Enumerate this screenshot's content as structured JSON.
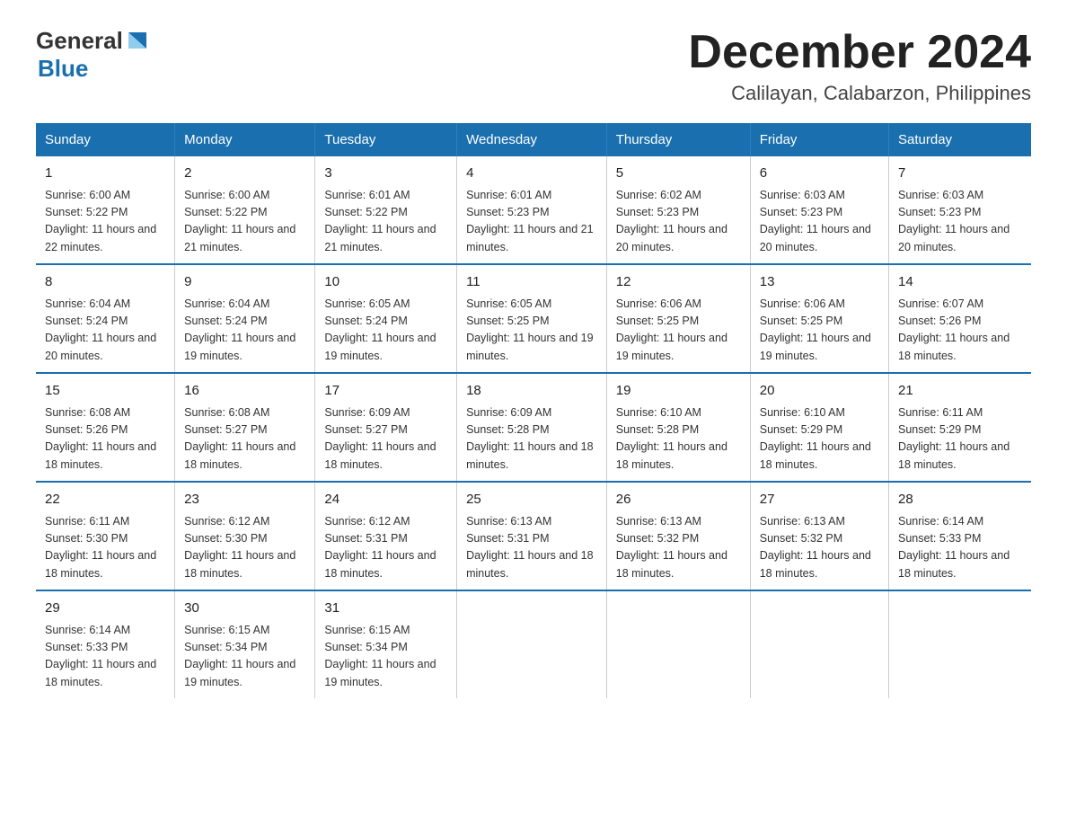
{
  "header": {
    "logo_general": "General",
    "logo_blue": "Blue",
    "main_title": "December 2024",
    "subtitle": "Calilayan, Calabarzon, Philippines"
  },
  "days_of_week": [
    "Sunday",
    "Monday",
    "Tuesday",
    "Wednesday",
    "Thursday",
    "Friday",
    "Saturday"
  ],
  "weeks": [
    [
      {
        "day": "1",
        "sunrise": "6:00 AM",
        "sunset": "5:22 PM",
        "daylight": "11 hours and 22 minutes."
      },
      {
        "day": "2",
        "sunrise": "6:00 AM",
        "sunset": "5:22 PM",
        "daylight": "11 hours and 21 minutes."
      },
      {
        "day": "3",
        "sunrise": "6:01 AM",
        "sunset": "5:22 PM",
        "daylight": "11 hours and 21 minutes."
      },
      {
        "day": "4",
        "sunrise": "6:01 AM",
        "sunset": "5:23 PM",
        "daylight": "11 hours and 21 minutes."
      },
      {
        "day": "5",
        "sunrise": "6:02 AM",
        "sunset": "5:23 PM",
        "daylight": "11 hours and 20 minutes."
      },
      {
        "day": "6",
        "sunrise": "6:03 AM",
        "sunset": "5:23 PM",
        "daylight": "11 hours and 20 minutes."
      },
      {
        "day": "7",
        "sunrise": "6:03 AM",
        "sunset": "5:23 PM",
        "daylight": "11 hours and 20 minutes."
      }
    ],
    [
      {
        "day": "8",
        "sunrise": "6:04 AM",
        "sunset": "5:24 PM",
        "daylight": "11 hours and 20 minutes."
      },
      {
        "day": "9",
        "sunrise": "6:04 AM",
        "sunset": "5:24 PM",
        "daylight": "11 hours and 19 minutes."
      },
      {
        "day": "10",
        "sunrise": "6:05 AM",
        "sunset": "5:24 PM",
        "daylight": "11 hours and 19 minutes."
      },
      {
        "day": "11",
        "sunrise": "6:05 AM",
        "sunset": "5:25 PM",
        "daylight": "11 hours and 19 minutes."
      },
      {
        "day": "12",
        "sunrise": "6:06 AM",
        "sunset": "5:25 PM",
        "daylight": "11 hours and 19 minutes."
      },
      {
        "day": "13",
        "sunrise": "6:06 AM",
        "sunset": "5:25 PM",
        "daylight": "11 hours and 19 minutes."
      },
      {
        "day": "14",
        "sunrise": "6:07 AM",
        "sunset": "5:26 PM",
        "daylight": "11 hours and 18 minutes."
      }
    ],
    [
      {
        "day": "15",
        "sunrise": "6:08 AM",
        "sunset": "5:26 PM",
        "daylight": "11 hours and 18 minutes."
      },
      {
        "day": "16",
        "sunrise": "6:08 AM",
        "sunset": "5:27 PM",
        "daylight": "11 hours and 18 minutes."
      },
      {
        "day": "17",
        "sunrise": "6:09 AM",
        "sunset": "5:27 PM",
        "daylight": "11 hours and 18 minutes."
      },
      {
        "day": "18",
        "sunrise": "6:09 AM",
        "sunset": "5:28 PM",
        "daylight": "11 hours and 18 minutes."
      },
      {
        "day": "19",
        "sunrise": "6:10 AM",
        "sunset": "5:28 PM",
        "daylight": "11 hours and 18 minutes."
      },
      {
        "day": "20",
        "sunrise": "6:10 AM",
        "sunset": "5:29 PM",
        "daylight": "11 hours and 18 minutes."
      },
      {
        "day": "21",
        "sunrise": "6:11 AM",
        "sunset": "5:29 PM",
        "daylight": "11 hours and 18 minutes."
      }
    ],
    [
      {
        "day": "22",
        "sunrise": "6:11 AM",
        "sunset": "5:30 PM",
        "daylight": "11 hours and 18 minutes."
      },
      {
        "day": "23",
        "sunrise": "6:12 AM",
        "sunset": "5:30 PM",
        "daylight": "11 hours and 18 minutes."
      },
      {
        "day": "24",
        "sunrise": "6:12 AM",
        "sunset": "5:31 PM",
        "daylight": "11 hours and 18 minutes."
      },
      {
        "day": "25",
        "sunrise": "6:13 AM",
        "sunset": "5:31 PM",
        "daylight": "11 hours and 18 minutes."
      },
      {
        "day": "26",
        "sunrise": "6:13 AM",
        "sunset": "5:32 PM",
        "daylight": "11 hours and 18 minutes."
      },
      {
        "day": "27",
        "sunrise": "6:13 AM",
        "sunset": "5:32 PM",
        "daylight": "11 hours and 18 minutes."
      },
      {
        "day": "28",
        "sunrise": "6:14 AM",
        "sunset": "5:33 PM",
        "daylight": "11 hours and 18 minutes."
      }
    ],
    [
      {
        "day": "29",
        "sunrise": "6:14 AM",
        "sunset": "5:33 PM",
        "daylight": "11 hours and 18 minutes."
      },
      {
        "day": "30",
        "sunrise": "6:15 AM",
        "sunset": "5:34 PM",
        "daylight": "11 hours and 19 minutes."
      },
      {
        "day": "31",
        "sunrise": "6:15 AM",
        "sunset": "5:34 PM",
        "daylight": "11 hours and 19 minutes."
      },
      null,
      null,
      null,
      null
    ]
  ]
}
